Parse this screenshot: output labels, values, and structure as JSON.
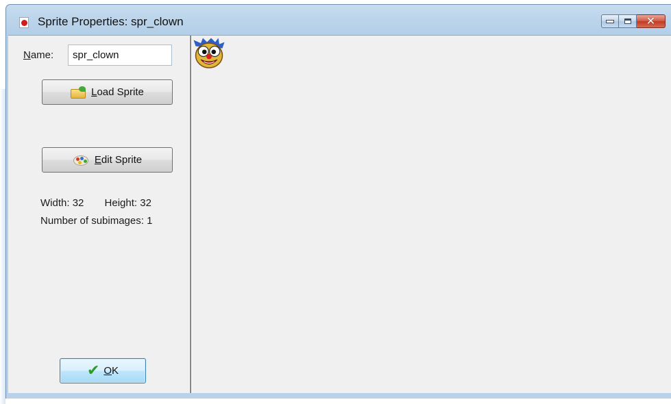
{
  "window": {
    "title": "Sprite Properties: spr_clown",
    "icon": "app-icon",
    "caption_buttons": [
      "minimize",
      "maximize",
      "close"
    ]
  },
  "form": {
    "name_label_first": "N",
    "name_label_rest": "ame:",
    "name_value": "spr_clown"
  },
  "buttons": {
    "load_sprite": {
      "mnemonic": "L",
      "rest": "oad Sprite",
      "icon": "folder-open-icon"
    },
    "edit_sprite": {
      "mnemonic": "E",
      "rest": "dit Sprite",
      "icon": "palette-icon"
    },
    "ok": {
      "mnemonic": "O",
      "rest": "K",
      "icon": "checkmark-icon"
    }
  },
  "info": {
    "width_label": "Width:",
    "width_value": "32",
    "height_label": "Height:",
    "height_value": "32",
    "subimages_label": "Number of subimages:",
    "subimages_value": "1"
  },
  "preview": {
    "sprite_icon": "clown-face-sprite"
  },
  "colors": {
    "title_bar": "#b9d2ea",
    "client_bg": "#f0f0f0",
    "close_button": "#c13a24",
    "ok_button_border": "#3c7fb1"
  }
}
